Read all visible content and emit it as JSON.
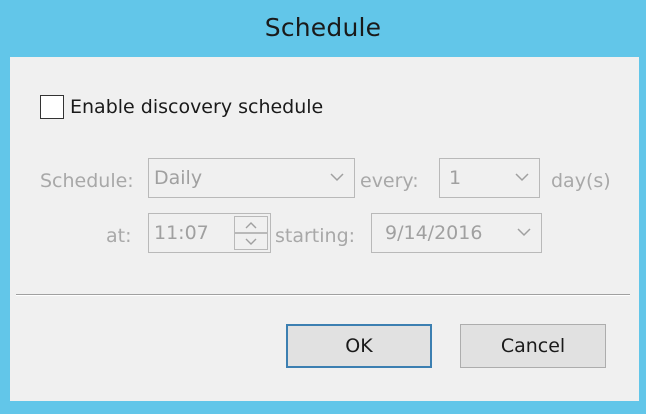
{
  "window": {
    "title": "Schedule"
  },
  "enable_checkbox": {
    "label": "Enable discovery schedule",
    "checked": false
  },
  "schedule_row": {
    "schedule_label": "Schedule:",
    "schedule_value": "Daily",
    "every_label": "every:",
    "every_value": "1",
    "unit_label": "day(s)"
  },
  "time_row": {
    "at_label": "at:",
    "time_value": "11:07",
    "starting_label": "starting:",
    "date_value": "9/14/2016"
  },
  "buttons": {
    "ok": "OK",
    "cancel": "Cancel"
  },
  "colors": {
    "title_bar": "#62c6e9",
    "dialog_bg": "#f0f0f0",
    "disabled_text": "#a8a8a8",
    "default_button_border": "#3c7fb1"
  },
  "icons": {
    "combo_arrow": "chevron-down-icon",
    "spin_up": "chevron-up-icon",
    "spin_down": "chevron-down-icon"
  }
}
